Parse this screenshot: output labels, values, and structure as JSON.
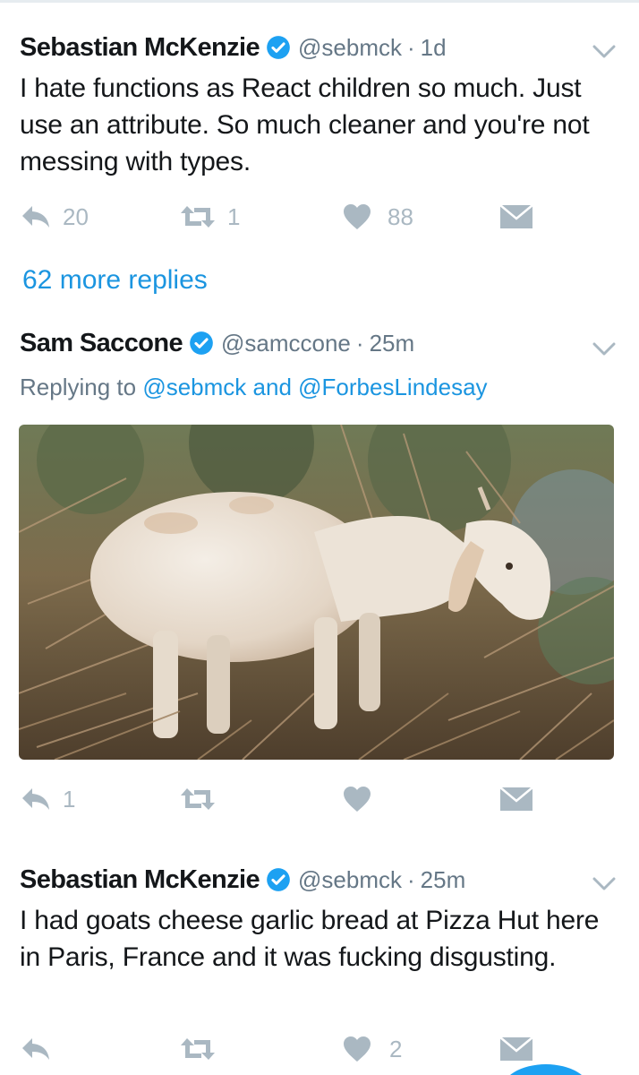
{
  "tweets": [
    {
      "name": "Sebastian McKenzie",
      "handle": "@sebmck",
      "time": "1d",
      "text": "I hate functions as React children so much. Just use an attribute. So much cleaner and you're not messing with types.",
      "reply_count": "20",
      "retweet_count": "1",
      "like_count": "88",
      "more_replies": "62 more replies"
    },
    {
      "name": "Sam Saccone",
      "handle": "@samccone",
      "time": "25m",
      "replying_prefix": "Replying to",
      "replying_user1": "@sebmck",
      "replying_and": "and",
      "replying_user2": "@ForbesLindesay",
      "photo_icon": "goat-photo",
      "reply_count": "1",
      "retweet_count": "",
      "like_count": ""
    },
    {
      "name": "Sebastian McKenzie",
      "handle": "@sebmck",
      "time": "25m",
      "text": "I had goats cheese garlic bread at Pizza Hut here in Paris, France and it was fucking disgusting.",
      "reply_count": "",
      "retweet_count": "",
      "like_count": "2"
    }
  ],
  "separator": "·",
  "icons": {
    "reply": "reply-icon",
    "retweet": "retweet-icon",
    "like": "heart-icon",
    "dm": "envelope-icon",
    "verified": "verified-badge-icon",
    "more": "chevron-down-icon"
  },
  "colors": {
    "link": "#1b95e0",
    "verified": "#1da1f2",
    "icon": "#aab8c2",
    "meta": "#657786",
    "text": "#14171a"
  }
}
